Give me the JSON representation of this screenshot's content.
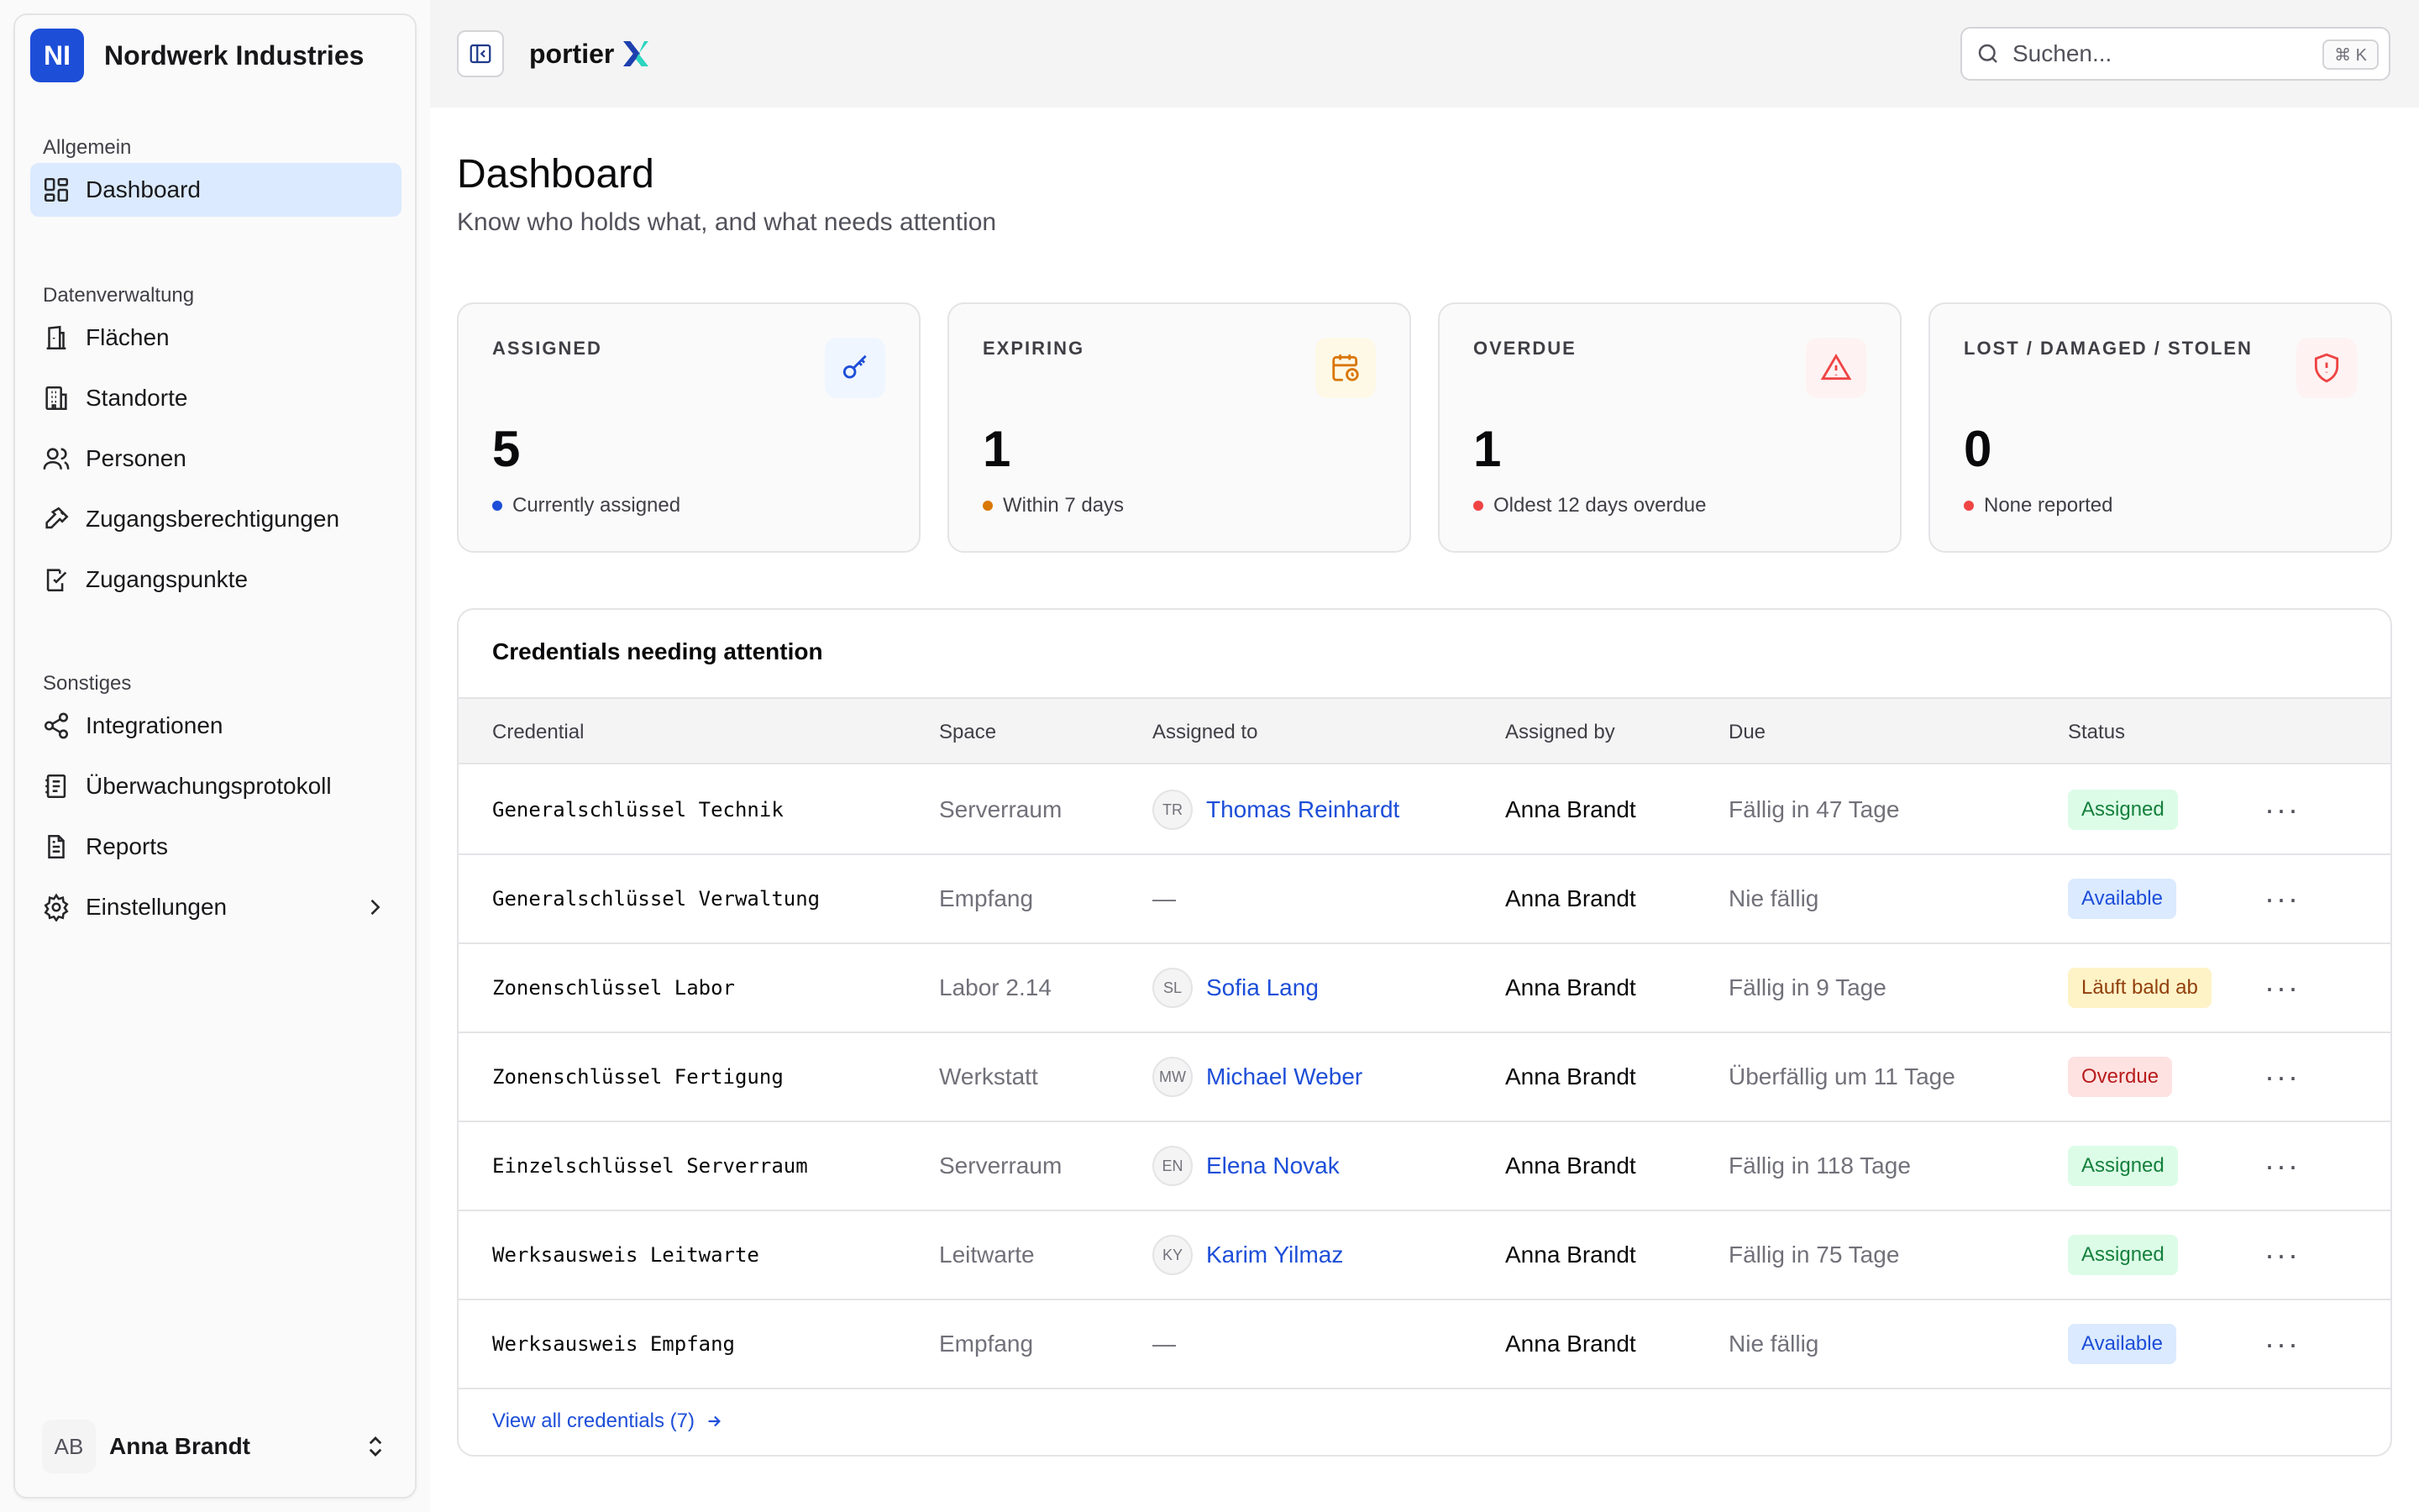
{
  "sidebar": {
    "org_initials": "NI",
    "org_name": "Nordwerk Industries",
    "groups": [
      {
        "label": "Allgemein"
      },
      {
        "label": "Datenverwaltung"
      },
      {
        "label": "Sonstiges"
      }
    ],
    "items": [
      {
        "label": "Dashboard",
        "icon": "dashboard-icon",
        "active": true
      },
      {
        "label": "Flächen",
        "icon": "building-icon"
      },
      {
        "label": "Standorte",
        "icon": "office-icon"
      },
      {
        "label": "Personen",
        "icon": "users-icon"
      },
      {
        "label": "Zugangsberechtigungen",
        "icon": "key-icon"
      },
      {
        "label": "Zugangspunkte",
        "icon": "door-icon"
      },
      {
        "label": "Integrationen",
        "icon": "share-icon"
      },
      {
        "label": "Überwachungsprotokoll",
        "icon": "log-icon"
      },
      {
        "label": "Reports",
        "icon": "report-icon"
      },
      {
        "label": "Einstellungen",
        "icon": "gear-icon"
      }
    ],
    "user": {
      "initials": "AB",
      "name": "Anna Brandt"
    }
  },
  "topbar": {
    "brand": "portier",
    "search_placeholder": "Suchen...",
    "search_shortcut": "⌘ K"
  },
  "main": {
    "title": "Dashboard",
    "subtitle": "Know who holds what, and what needs attention",
    "stats": [
      {
        "label": "ASSIGNED",
        "value": "5",
        "note": "Currently assigned",
        "dot": "#1d4ed8",
        "icon_bg": "#eff6ff",
        "icon_color": "#1d4ed8"
      },
      {
        "label": "EXPIRING",
        "value": "1",
        "note": "Within 7 days",
        "dot": "#d97706",
        "icon_bg": "#fef9e7",
        "icon_color": "#d97706"
      },
      {
        "label": "OVERDUE",
        "value": "1",
        "note": "Oldest 12 days overdue",
        "dot": "#ef4444",
        "icon_bg": "#fef2f2",
        "icon_color": "#ef4444"
      },
      {
        "label": "LOST / DAMAGED / STOLEN",
        "value": "0",
        "note": "None reported",
        "dot": "#ef4444",
        "icon_bg": "#fef2f2",
        "icon_color": "#ef4444"
      }
    ],
    "table": {
      "title": "Credentials needing attention",
      "columns": [
        "Credential",
        "Space",
        "Assigned to",
        "Assigned by",
        "Due",
        "Status"
      ],
      "rows": [
        {
          "credential": "Generalschlüssel Technik",
          "space": "Serverraum",
          "initials": "TR",
          "assigned_to": "Thomas Reinhardt",
          "assigned_by": "Anna Brandt",
          "due": "Fällig in 47 Tage",
          "status": "Assigned"
        },
        {
          "credential": "Generalschlüssel Verwaltung",
          "space": "Empfang",
          "initials": "",
          "assigned_to": "—",
          "assigned_by": "Anna Brandt",
          "due": "Nie fällig",
          "status": "Available"
        },
        {
          "credential": "Zonenschlüssel Labor",
          "space": "Labor 2.14",
          "initials": "SL",
          "assigned_to": "Sofia Lang",
          "assigned_by": "Anna Brandt",
          "due": "Fällig in 9 Tage",
          "status": "Läuft bald ab"
        },
        {
          "credential": "Zonenschlüssel Fertigung",
          "space": "Werkstatt",
          "initials": "MW",
          "assigned_to": "Michael Weber",
          "assigned_by": "Anna Brandt",
          "due": "Überfällig um 11 Tage",
          "status": "Overdue"
        },
        {
          "credential": "Einzelschlüssel Serverraum",
          "space": "Serverraum",
          "initials": "EN",
          "assigned_to": "Elena Novak",
          "assigned_by": "Anna Brandt",
          "due": "Fällig in 118 Tage",
          "status": "Assigned"
        },
        {
          "credential": "Werksausweis Leitwarte",
          "space": "Leitwarte",
          "initials": "KY",
          "assigned_to": "Karim Yilmaz",
          "assigned_by": "Anna Brandt",
          "due": "Fällig in 75 Tage",
          "status": "Assigned"
        },
        {
          "credential": "Werksausweis Empfang",
          "space": "Empfang",
          "initials": "",
          "assigned_to": "—",
          "assigned_by": "Anna Brandt",
          "due": "Nie fällig",
          "status": "Available"
        }
      ],
      "row_menu": "···",
      "view_all": "View all credentials (7)"
    },
    "status_colors": {
      "Assigned": {
        "bg": "#dcfce7",
        "fg": "#15803d"
      },
      "Available": {
        "bg": "#dbeafe",
        "fg": "#1d4ed8"
      },
      "Läuft bald ab": {
        "bg": "#fef3c7",
        "fg": "#92400e"
      },
      "Overdue": {
        "bg": "#fee2e2",
        "fg": "#b91c1c"
      }
    }
  }
}
